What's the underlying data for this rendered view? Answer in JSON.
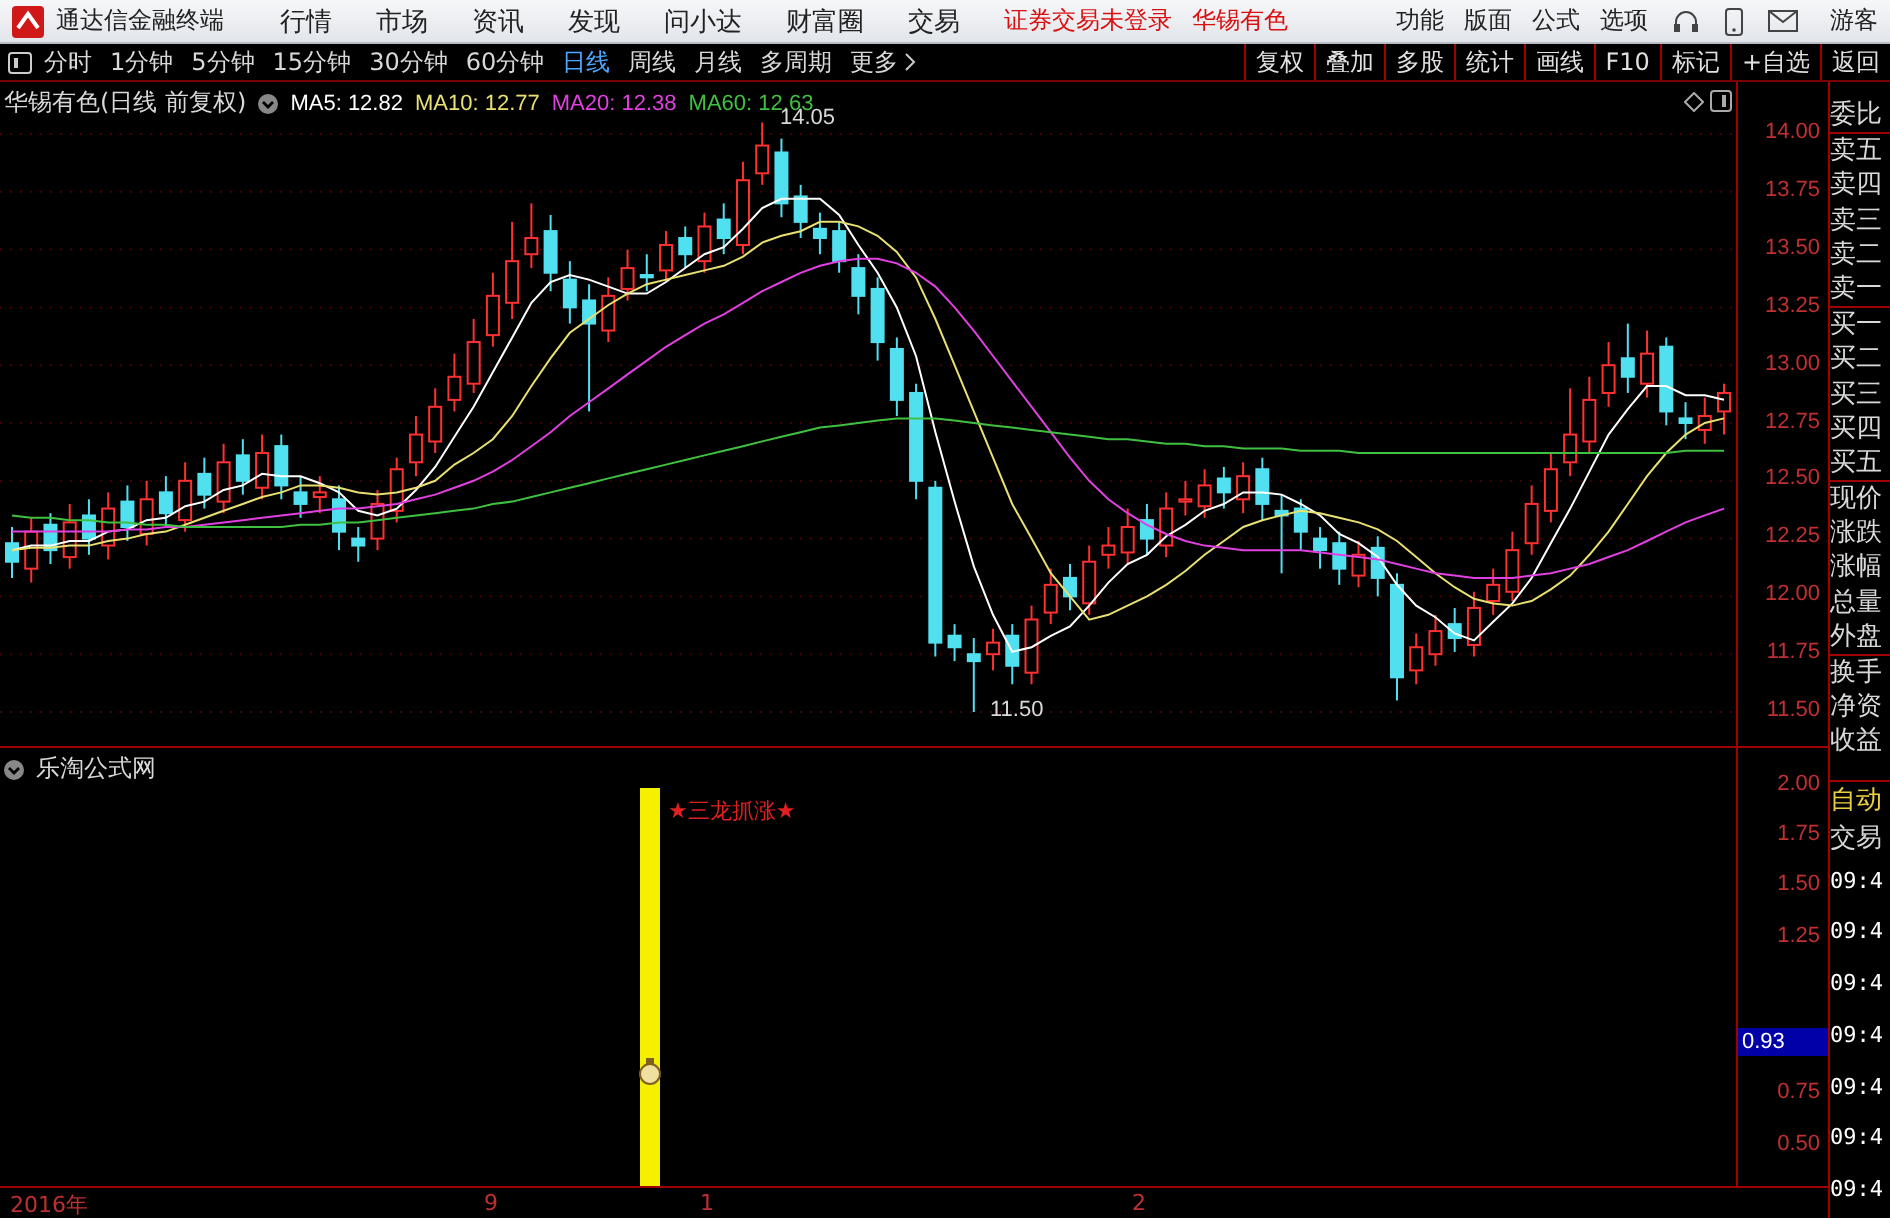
{
  "app": {
    "title": "通达信金融终端",
    "menu": [
      "行情",
      "市场",
      "资讯",
      "发现",
      "问小达",
      "财富圈",
      "交易"
    ],
    "login_status": "证券交易未登录",
    "stock": "华锡有色",
    "tools": [
      "功能",
      "版面",
      "公式",
      "选项"
    ],
    "user": "游客"
  },
  "periods": [
    {
      "label": "分时",
      "selected": false
    },
    {
      "label": "1分钟",
      "selected": false
    },
    {
      "label": "5分钟",
      "selected": false
    },
    {
      "label": "15分钟",
      "selected": false
    },
    {
      "label": "30分钟",
      "selected": false
    },
    {
      "label": "60分钟",
      "selected": false
    },
    {
      "label": "日线",
      "selected": true
    },
    {
      "label": "周线",
      "selected": false
    },
    {
      "label": "月线",
      "selected": false
    },
    {
      "label": "多周期",
      "selected": false
    },
    {
      "label": "更多",
      "selected": false
    }
  ],
  "chart_tools": [
    "复权",
    "叠加",
    "多股",
    "统计",
    "画线",
    "F10",
    "标记",
    "+自选",
    "返回"
  ],
  "main_chart": {
    "title": "华锡有色(日线 前复权)",
    "ma": [
      {
        "separator": ":",
        "value": "12.82",
        "color": "#ffffff"
      },
      {
        "separator": ":",
        "value": "12.77",
        "color": "#e8e070"
      },
      {
        "separator": ":",
        "value": "12.38",
        "color": "#e040e0"
      },
      {
        "separator": ":",
        "value": "12.63",
        "color": "#40c040"
      }
    ],
    "chart_data": {
      "type": "candlestick",
      "grid": true,
      "ylim": [
        11.5,
        14
      ],
      "yticks": [
        {
          "value": 14,
          "label": "14.00"
        },
        {
          "value": 13.75,
          "label": "13.75"
        },
        {
          "value": 13.5,
          "label": "13.50"
        },
        {
          "value": 13.25,
          "label": "13.25"
        },
        {
          "value": 13,
          "label": "13.00"
        },
        {
          "value": 12.75,
          "label": "12.75"
        },
        {
          "value": 12.5,
          "label": "12.50"
        },
        {
          "value": 12.25,
          "label": "12.25"
        },
        {
          "value": 12,
          "label": "12.00"
        },
        {
          "value": 11.75,
          "label": "11.75"
        },
        {
          "value": 11.5,
          "label": "11.50"
        }
      ],
      "ohlc": [
        [
          12.23,
          12.3,
          12.08,
          12.15
        ],
        [
          12.12,
          12.34,
          12.06,
          12.28
        ],
        [
          12.31,
          12.36,
          12.14,
          12.2
        ],
        [
          12.17,
          12.4,
          12.12,
          12.32
        ],
        [
          12.35,
          12.42,
          12.18,
          12.25
        ],
        [
          12.22,
          12.45,
          12.16,
          12.38
        ],
        [
          12.41,
          12.48,
          12.24,
          12.3
        ],
        [
          12.27,
          12.5,
          12.22,
          12.42
        ],
        [
          12.45,
          12.52,
          12.3,
          12.36
        ],
        [
          12.33,
          12.58,
          12.28,
          12.5
        ],
        [
          12.53,
          12.6,
          12.38,
          12.44
        ],
        [
          12.41,
          12.66,
          12.36,
          12.58
        ],
        [
          12.61,
          12.68,
          12.44,
          12.5
        ],
        [
          12.47,
          12.7,
          12.42,
          12.62
        ],
        [
          12.65,
          12.7,
          12.42,
          12.48
        ],
        [
          12.45,
          12.52,
          12.34,
          12.4
        ],
        [
          12.43,
          12.52,
          12.36,
          12.45
        ],
        [
          12.42,
          12.48,
          12.2,
          12.28
        ],
        [
          12.25,
          12.3,
          12.15,
          12.22
        ],
        [
          12.25,
          12.46,
          12.2,
          12.4
        ],
        [
          12.37,
          12.6,
          12.32,
          12.55
        ],
        [
          12.58,
          12.78,
          12.52,
          12.7
        ],
        [
          12.67,
          12.9,
          12.62,
          12.82
        ],
        [
          12.85,
          13.05,
          12.8,
          12.95
        ],
        [
          12.92,
          13.2,
          12.88,
          13.1
        ],
        [
          13.13,
          13.4,
          13.08,
          13.3
        ],
        [
          13.27,
          13.62,
          13.2,
          13.45
        ],
        [
          13.48,
          13.7,
          13.42,
          13.55
        ],
        [
          13.58,
          13.65,
          13.32,
          13.4
        ],
        [
          13.37,
          13.45,
          13.18,
          13.25
        ],
        [
          13.28,
          13.35,
          12.8,
          13.18
        ],
        [
          13.15,
          13.38,
          13.1,
          13.3
        ],
        [
          13.33,
          13.5,
          13.28,
          13.42
        ],
        [
          13.39,
          13.48,
          13.32,
          13.38
        ],
        [
          13.41,
          13.58,
          13.36,
          13.52
        ],
        [
          13.55,
          13.6,
          13.42,
          13.48
        ],
        [
          13.45,
          13.66,
          13.4,
          13.6
        ],
        [
          13.63,
          13.7,
          13.48,
          13.55
        ],
        [
          13.52,
          13.88,
          13.48,
          13.8
        ],
        [
          13.83,
          14.05,
          13.78,
          13.95
        ],
        [
          13.92,
          13.98,
          13.64,
          13.7
        ],
        [
          13.73,
          13.78,
          13.55,
          13.62
        ],
        [
          13.59,
          13.66,
          13.48,
          13.55
        ],
        [
          13.58,
          13.62,
          13.4,
          13.45
        ],
        [
          13.42,
          13.48,
          13.22,
          13.3
        ],
        [
          13.33,
          13.38,
          13.02,
          13.1
        ],
        [
          13.07,
          13.12,
          12.78,
          12.85
        ],
        [
          12.88,
          12.92,
          12.42,
          12.5
        ],
        [
          12.47,
          12.5,
          11.74,
          11.8
        ],
        [
          11.83,
          11.88,
          11.72,
          11.78
        ],
        [
          11.75,
          11.82,
          11.5,
          11.72
        ],
        [
          11.75,
          11.86,
          11.68,
          11.8
        ],
        [
          11.83,
          11.88,
          11.62,
          11.7
        ],
        [
          11.67,
          11.96,
          11.62,
          11.9
        ],
        [
          11.93,
          12.12,
          11.88,
          12.05
        ],
        [
          12.08,
          12.14,
          11.94,
          12.0
        ],
        [
          11.97,
          12.22,
          11.92,
          12.15
        ],
        [
          12.18,
          12.3,
          12.12,
          12.22
        ],
        [
          12.19,
          12.38,
          12.14,
          12.3
        ],
        [
          12.33,
          12.4,
          12.18,
          12.25
        ],
        [
          12.22,
          12.45,
          12.17,
          12.38
        ],
        [
          12.41,
          12.5,
          12.35,
          12.42
        ],
        [
          12.39,
          12.55,
          12.34,
          12.48
        ],
        [
          12.51,
          12.56,
          12.38,
          12.45
        ],
        [
          12.42,
          12.58,
          12.36,
          12.52
        ],
        [
          12.55,
          12.6,
          12.33,
          12.4
        ],
        [
          12.37,
          12.44,
          12.1,
          12.35
        ],
        [
          12.38,
          12.42,
          12.2,
          12.28
        ],
        [
          12.25,
          12.3,
          12.12,
          12.2
        ],
        [
          12.23,
          12.28,
          12.05,
          12.12
        ],
        [
          12.09,
          12.24,
          12.04,
          12.18
        ],
        [
          12.21,
          12.26,
          12.0,
          12.08
        ],
        [
          12.05,
          12.1,
          11.55,
          11.65
        ],
        [
          11.68,
          11.84,
          11.62,
          11.78
        ],
        [
          11.75,
          11.92,
          11.7,
          11.85
        ],
        [
          11.88,
          11.95,
          11.76,
          11.82
        ],
        [
          11.79,
          12.02,
          11.74,
          11.95
        ],
        [
          11.98,
          12.12,
          11.92,
          12.05
        ],
        [
          12.02,
          12.28,
          11.98,
          12.2
        ],
        [
          12.23,
          12.48,
          12.18,
          12.4
        ],
        [
          12.37,
          12.62,
          12.32,
          12.55
        ],
        [
          12.58,
          12.9,
          12.52,
          12.7
        ],
        [
          12.67,
          12.95,
          12.62,
          12.85
        ],
        [
          12.88,
          13.1,
          12.82,
          13.0
        ],
        [
          13.03,
          13.18,
          12.88,
          12.95
        ],
        [
          12.92,
          13.15,
          12.86,
          13.05
        ],
        [
          13.08,
          13.12,
          12.74,
          12.8
        ],
        [
          12.77,
          12.84,
          12.68,
          12.75
        ],
        [
          12.72,
          12.86,
          12.66,
          12.78
        ],
        [
          12.8,
          12.92,
          12.7,
          12.88
        ]
      ],
      "series": [
        {
          "name": "MA5",
          "type": "line",
          "color": "#ffffff",
          "values": [
            12.2,
            12.22,
            12.22,
            12.24,
            12.24,
            12.28,
            12.29,
            12.33,
            12.34,
            12.39,
            12.41,
            12.46,
            12.48,
            12.53,
            12.52,
            12.52,
            12.49,
            12.45,
            12.37,
            12.35,
            12.38,
            12.46,
            12.56,
            12.69,
            12.82,
            12.97,
            13.12,
            13.27,
            13.36,
            13.39,
            13.37,
            13.34,
            13.31,
            13.31,
            13.36,
            13.42,
            13.48,
            13.51,
            13.59,
            13.68,
            13.72,
            13.72,
            13.72,
            13.65,
            13.52,
            13.4,
            13.25,
            13.04,
            12.71,
            12.41,
            12.13,
            11.92,
            11.76,
            11.78,
            11.83,
            11.87,
            11.96,
            12.06,
            12.14,
            12.18,
            12.26,
            12.31,
            12.37,
            12.4,
            12.45,
            12.45,
            12.44,
            12.4,
            12.35,
            12.27,
            12.23,
            12.17,
            12.05,
            11.96,
            11.91,
            11.84,
            11.81,
            11.89,
            11.97,
            12.08,
            12.23,
            12.38,
            12.54,
            12.7,
            12.81,
            12.91,
            12.91,
            12.87,
            12.87,
            12.85
          ]
        },
        {
          "name": "MA10",
          "type": "line",
          "color": "#e8e070",
          "values": [
            12.2,
            12.21,
            12.21,
            12.22,
            12.22,
            12.24,
            12.25,
            12.27,
            12.28,
            12.31,
            12.34,
            12.37,
            12.4,
            12.43,
            12.45,
            12.48,
            12.48,
            12.47,
            12.45,
            12.44,
            12.45,
            12.47,
            12.5,
            12.57,
            12.62,
            12.68,
            12.78,
            12.91,
            13.03,
            13.14,
            13.2,
            13.26,
            13.31,
            13.35,
            13.37,
            13.39,
            13.41,
            13.43,
            13.47,
            13.53,
            13.56,
            13.58,
            13.62,
            13.62,
            13.6,
            13.56,
            13.49,
            13.38,
            13.2,
            13.0,
            12.8,
            12.6,
            12.4,
            12.25,
            12.1,
            12.0,
            11.9,
            11.92,
            11.96,
            12.0,
            12.05,
            12.11,
            12.18,
            12.24,
            12.3,
            12.33,
            12.35,
            12.37,
            12.36,
            12.34,
            12.32,
            12.29,
            12.24,
            12.17,
            12.1,
            12.04,
            11.99,
            11.97,
            11.96,
            11.98,
            12.03,
            12.09,
            12.18,
            12.28,
            12.4,
            12.52,
            12.62,
            12.7,
            12.75,
            12.77
          ]
        },
        {
          "name": "MA20",
          "type": "line",
          "color": "#e040e0",
          "values": [
            12.28,
            12.28,
            12.28,
            12.28,
            12.28,
            12.28,
            12.29,
            12.29,
            12.3,
            12.3,
            12.31,
            12.32,
            12.33,
            12.34,
            12.35,
            12.36,
            12.37,
            12.38,
            12.38,
            12.39,
            12.4,
            12.42,
            12.44,
            12.47,
            12.5,
            12.54,
            12.59,
            12.65,
            12.71,
            12.78,
            12.84,
            12.9,
            12.96,
            13.02,
            13.08,
            13.13,
            13.18,
            13.22,
            13.27,
            13.32,
            13.36,
            13.4,
            13.43,
            13.45,
            13.46,
            13.46,
            13.44,
            13.4,
            13.34,
            13.25,
            13.15,
            13.04,
            12.93,
            12.82,
            12.71,
            12.6,
            12.5,
            12.42,
            12.36,
            12.31,
            12.27,
            12.24,
            12.22,
            12.21,
            12.2,
            12.2,
            12.2,
            12.2,
            12.19,
            12.18,
            12.17,
            12.16,
            12.14,
            12.12,
            12.1,
            12.09,
            12.08,
            12.08,
            12.08,
            12.09,
            12.1,
            12.12,
            12.14,
            12.17,
            12.2,
            12.24,
            12.28,
            12.32,
            12.35,
            12.38
          ]
        },
        {
          "name": "MA60",
          "type": "line",
          "color": "#40c040",
          "values": [
            12.35,
            12.34,
            12.34,
            12.33,
            12.33,
            12.32,
            12.32,
            12.31,
            12.31,
            12.3,
            12.3,
            12.3,
            12.3,
            12.3,
            12.3,
            12.31,
            12.31,
            12.32,
            12.32,
            12.33,
            12.34,
            12.35,
            12.36,
            12.37,
            12.38,
            12.4,
            12.41,
            12.43,
            12.45,
            12.47,
            12.49,
            12.51,
            12.53,
            12.55,
            12.57,
            12.59,
            12.61,
            12.63,
            12.65,
            12.67,
            12.69,
            12.71,
            12.73,
            12.74,
            12.75,
            12.76,
            12.77,
            12.77,
            12.77,
            12.76,
            12.75,
            12.74,
            12.73,
            12.72,
            12.71,
            12.7,
            12.69,
            12.68,
            12.68,
            12.67,
            12.66,
            12.66,
            12.65,
            12.65,
            12.64,
            12.64,
            12.64,
            12.63,
            12.63,
            12.63,
            12.62,
            12.62,
            12.62,
            12.62,
            12.62,
            12.62,
            12.62,
            12.62,
            12.62,
            12.62,
            12.62,
            12.62,
            12.62,
            12.62,
            12.62,
            12.62,
            12.62,
            12.63,
            12.63,
            12.63
          ]
        }
      ]
    },
    "high_label": "14.05",
    "low_label": "11.50"
  },
  "indicator": {
    "title": "乐淘公式网",
    "signal": "★三龙抓涨★",
    "ticks": [
      {
        "label": "2.00",
        "current": false
      },
      {
        "label": "1.75",
        "current": false
      },
      {
        "label": "1.50",
        "current": false
      },
      {
        "label": "1.25",
        "current": false
      },
      {
        "label": "0.93",
        "current": true
      },
      {
        "label": "0.75",
        "current": false
      },
      {
        "label": "0.50",
        "current": false
      }
    ]
  },
  "date_axis": [
    "2016年",
    "9",
    "1",
    "2"
  ],
  "quote_panel": {
    "labels": [
      "委比",
      "卖五",
      "卖四",
      "卖三",
      "卖二",
      "卖一",
      "买一",
      "买二",
      "买三",
      "买四",
      "买五",
      "现价",
      "涨跌",
      "涨幅",
      "总量",
      "外盘",
      "换手",
      "净资",
      "收益"
    ],
    "mode": "自动",
    "trade": "交易",
    "times": [
      "09:4",
      "09:4",
      "09:4",
      "09:4",
      "09:4",
      "09:4",
      "09:4"
    ]
  }
}
